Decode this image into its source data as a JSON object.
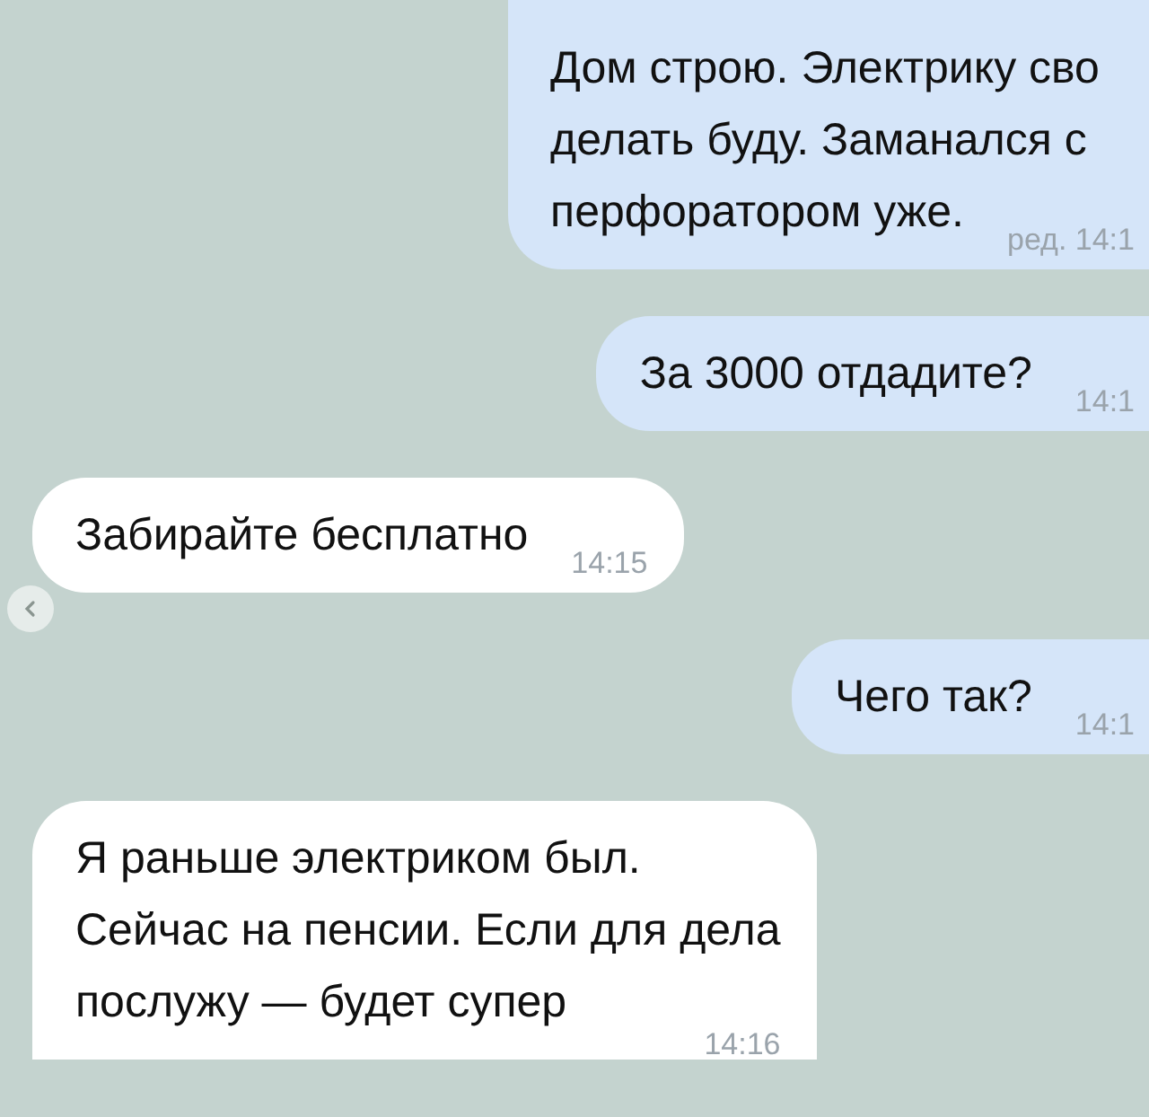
{
  "messages": [
    {
      "kind": "outgoing",
      "lines": [
        "Дом строю. Электрику сво",
        "делать буду. Заманался с",
        "перфоратором уже."
      ],
      "time": "ред. 14:1"
    },
    {
      "kind": "outgoing",
      "lines": [
        "За 3000 отдадите?"
      ],
      "time": "14:1"
    },
    {
      "kind": "incoming",
      "lines": [
        "Забирайте бесплатно"
      ],
      "time": "14:15"
    },
    {
      "kind": "outgoing",
      "lines": [
        "Чего так?"
      ],
      "time": "14:1"
    },
    {
      "kind": "incoming",
      "lines": [
        "Я раньше электриком был.",
        "Сейчас на пенсии. Если для дела",
        "послужу — будет супер"
      ],
      "time": "14:16"
    }
  ]
}
